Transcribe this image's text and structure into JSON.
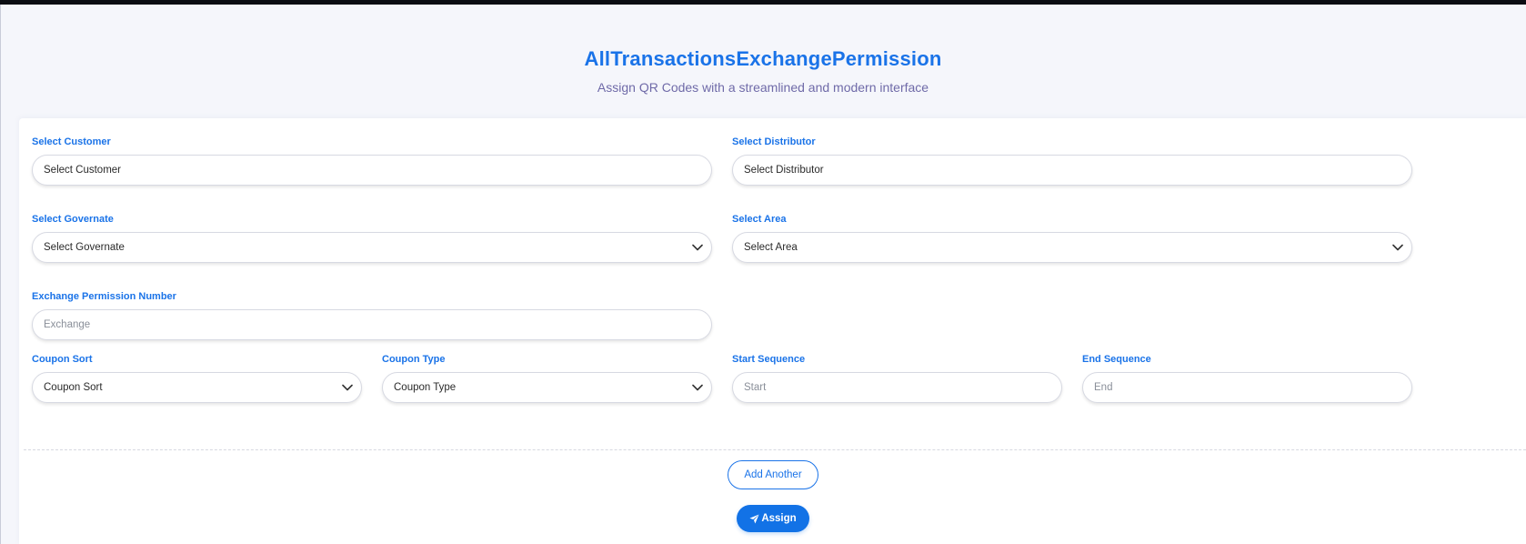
{
  "page": {
    "title": "AllTransactionsExchangePermission",
    "subtitle": "Assign QR Codes with a streamlined and modern interface"
  },
  "form": {
    "customer": {
      "label": "Select Customer",
      "value": "Select Customer"
    },
    "distributor": {
      "label": "Select Distributor",
      "value": "Select Distributor"
    },
    "governate": {
      "label": "Select Governate",
      "value": "Select Governate"
    },
    "area": {
      "label": "Select Area",
      "value": "Select Area"
    },
    "exchange_permission": {
      "label": "Exchange Permission Number",
      "placeholder": "Exchange"
    },
    "coupon_sort": {
      "label": "Coupon Sort",
      "value": "Coupon Sort"
    },
    "coupon_type": {
      "label": "Coupon Type",
      "value": "Coupon Type"
    },
    "start_sequence": {
      "label": "Start Sequence",
      "placeholder": "Start"
    },
    "end_sequence": {
      "label": "End Sequence",
      "placeholder": "End"
    }
  },
  "actions": {
    "add_another": "Add Another",
    "assign": "Assign"
  },
  "icons": {
    "select_chevron": "chevron-down-icon",
    "assign_icon": "paper-plane-icon"
  },
  "colors": {
    "accent": "#1a73e8",
    "subtitle": "#6f6aa8",
    "background": "#f5f6fb"
  }
}
